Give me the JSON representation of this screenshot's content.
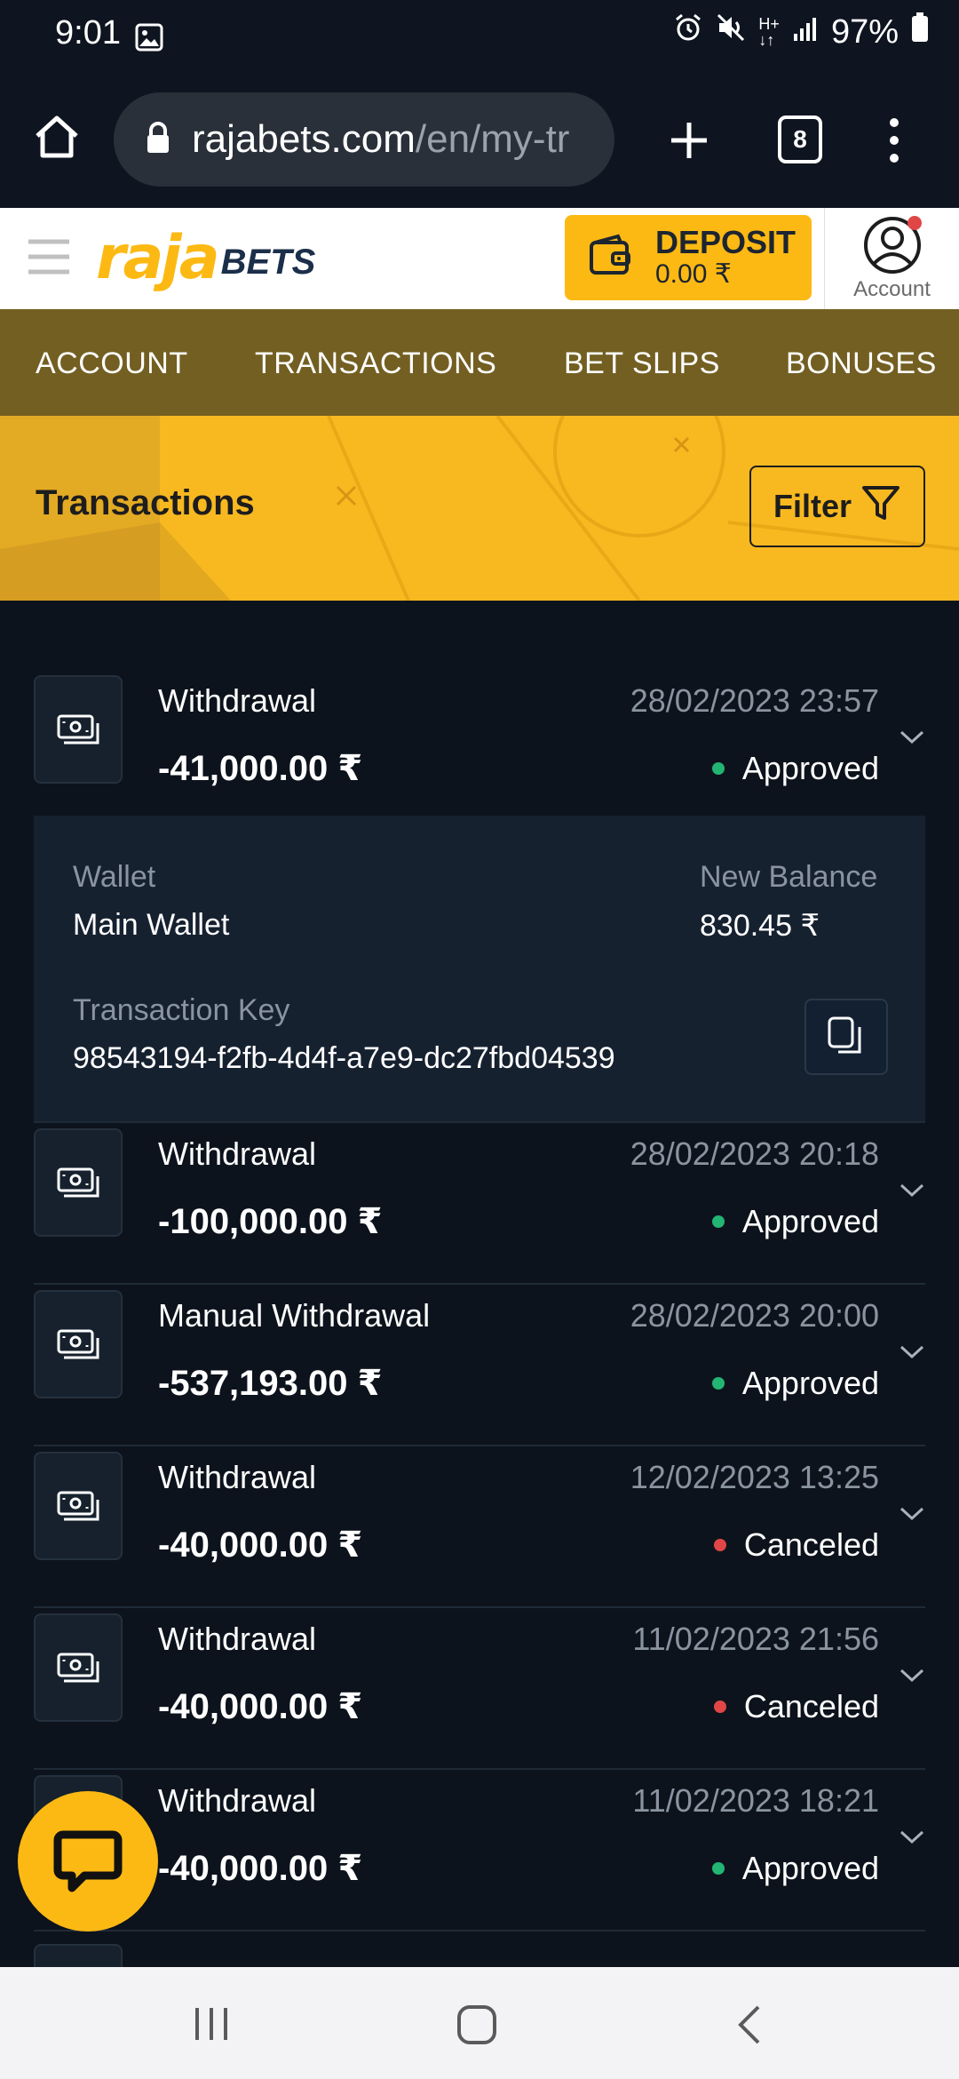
{
  "status_bar": {
    "time": "9:01",
    "battery": "97%"
  },
  "browser": {
    "url_main": "rajabets.com",
    "url_path": "/en/my-tr",
    "tab_count": "8"
  },
  "site": {
    "logo_text_1": "raja",
    "logo_text_2": "BETS",
    "deposit_label": "DEPOSIT",
    "deposit_amount": "0.00 ₹",
    "account_label": "Account"
  },
  "nav": {
    "tabs": [
      "ACCOUNT",
      "TRANSACTIONS",
      "BET SLIPS",
      "BONUSES"
    ]
  },
  "banner": {
    "title": "Transactions",
    "filter_label": "Filter"
  },
  "expanded": {
    "wallet_label": "Wallet",
    "wallet_value": "Main Wallet",
    "balance_label": "New Balance",
    "balance_value": "830.45 ₹",
    "key_label": "Transaction Key",
    "key_value": "98543194-f2fb-4d4f-a7e9-dc27fbd04539"
  },
  "transactions": [
    {
      "type": "Withdrawal",
      "amount": "-41,000.00 ₹",
      "date": "28/02/2023 23:57",
      "status": "Approved",
      "status_color": "#22b573"
    },
    {
      "type": "Withdrawal",
      "amount": "-100,000.00 ₹",
      "date": "28/02/2023 20:18",
      "status": "Approved",
      "status_color": "#22b573"
    },
    {
      "type": "Manual Withdrawal",
      "amount": "-537,193.00 ₹",
      "date": "28/02/2023 20:00",
      "status": "Approved",
      "status_color": "#22b573"
    },
    {
      "type": "Withdrawal",
      "amount": "-40,000.00 ₹",
      "date": "12/02/2023 13:25",
      "status": "Canceled",
      "status_color": "#e04646"
    },
    {
      "type": "Withdrawal",
      "amount": "-40,000.00 ₹",
      "date": "11/02/2023 21:56",
      "status": "Canceled",
      "status_color": "#e04646"
    },
    {
      "type": "Withdrawal",
      "amount": "-40,000.00 ₹",
      "date": "11/02/2023 18:21",
      "status": "Approved",
      "status_color": "#22b573"
    }
  ],
  "colors": {
    "accent": "#fdb913",
    "background": "#0d131c",
    "nav": "#735f22"
  }
}
